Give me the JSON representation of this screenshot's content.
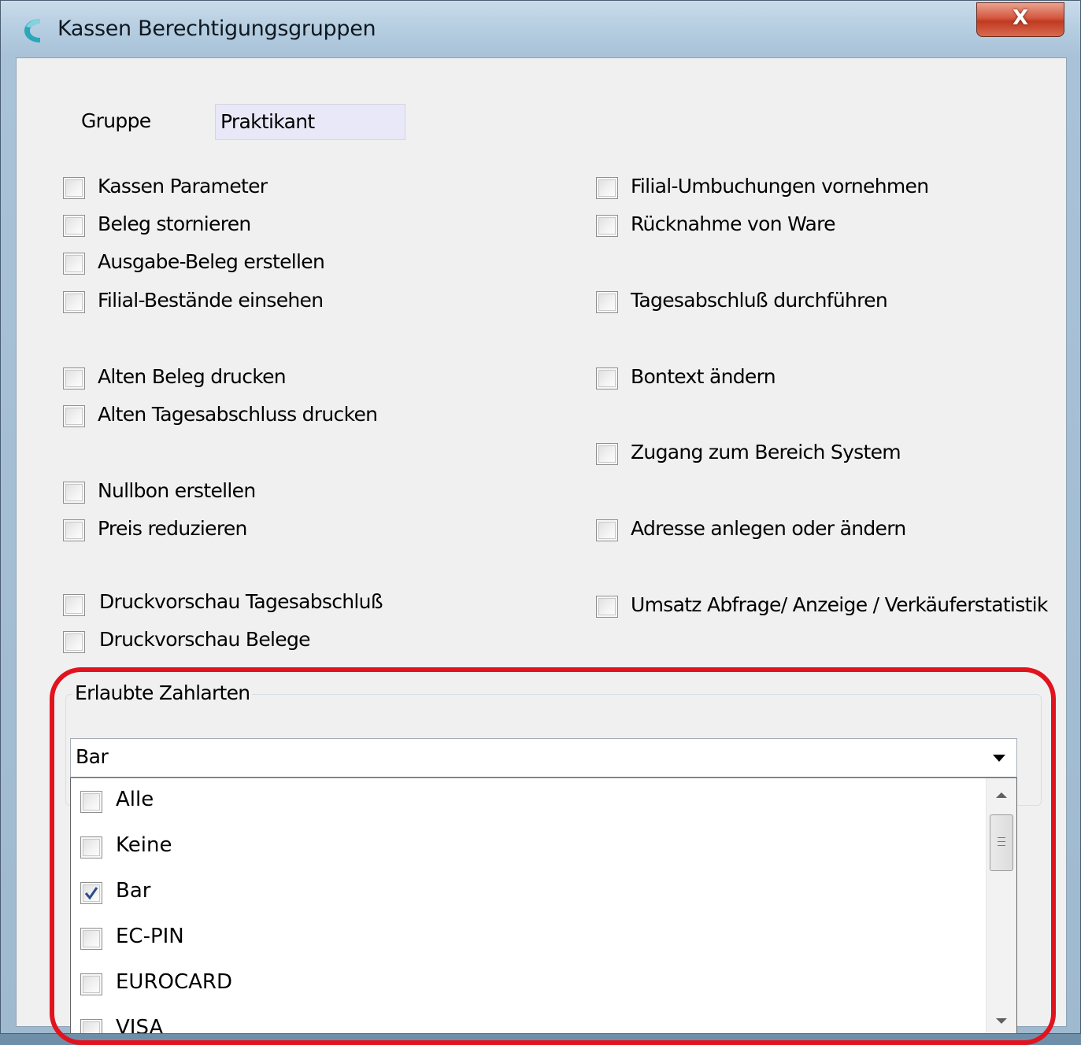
{
  "window": {
    "title": "Kassen Berechtigungsgruppen",
    "close_glyph": "X",
    "accent": "#d4573f"
  },
  "gruppe": {
    "label": "Gruppe",
    "value": "Praktikant"
  },
  "permissions_left": [
    {
      "label": "Kassen Parameter",
      "checked": false
    },
    {
      "label": "Beleg stornieren",
      "checked": false
    },
    {
      "label": "Ausgabe-Beleg erstellen",
      "checked": false
    },
    {
      "label": "Filial-Bestände einsehen",
      "checked": false
    },
    {
      "label": "Alten Beleg drucken",
      "checked": false
    },
    {
      "label": "Alten Tagesabschluss drucken",
      "checked": false
    },
    {
      "label": "Nullbon erstellen",
      "checked": false
    },
    {
      "label": "Preis reduzieren",
      "checked": false
    },
    {
      "label": "Druckvorschau Tagesabschluß",
      "checked": false
    },
    {
      "label": "Druckvorschau Belege",
      "checked": false
    }
  ],
  "permissions_right": [
    {
      "label": "Filial-Umbuchungen vornehmen",
      "checked": false
    },
    {
      "label": "Rücknahme von Ware",
      "checked": false
    },
    {
      "label": "Tagesabschluß durchführen",
      "checked": false
    },
    {
      "label": "Bontext ändern",
      "checked": false
    },
    {
      "label": "Zugang zum Bereich System",
      "checked": false
    },
    {
      "label": "Adresse anlegen oder ändern",
      "checked": false
    },
    {
      "label": "Umsatz Abfrage/ Anzeige / Verkäuferstatistik",
      "checked": false
    }
  ],
  "zahlarten": {
    "group_title": "Erlaubte Zahlarten",
    "selected": "Bar",
    "options": [
      {
        "label": "Alle",
        "checked": false
      },
      {
        "label": "Keine",
        "checked": false
      },
      {
        "label": "Bar",
        "checked": true
      },
      {
        "label": "EC-PIN",
        "checked": false
      },
      {
        "label": "EUROCARD",
        "checked": false
      },
      {
        "label": "VISA",
        "checked": false
      }
    ],
    "highlight_color": "#e0141e"
  }
}
